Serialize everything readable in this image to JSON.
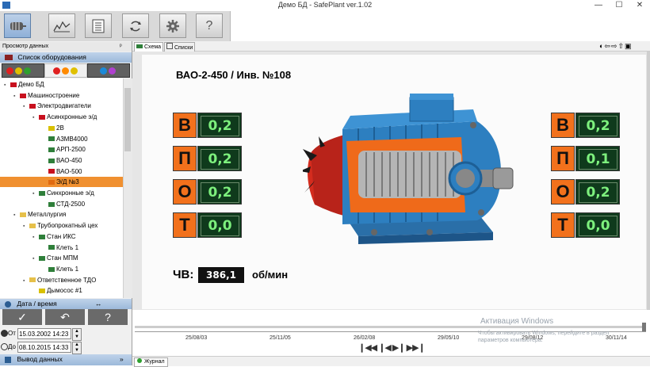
{
  "window": {
    "title": "Демо БД - SafePlant ver.1.02",
    "minimize": "—",
    "maximize": "☐",
    "close": "✕"
  },
  "toolbar": {
    "buttons": [
      "motor",
      "chart",
      "report",
      "refresh",
      "settings",
      "help"
    ],
    "help_label": "?"
  },
  "left": {
    "view_header": "Просмотр данных",
    "pin": "ᵖ",
    "equipment_header": "Список оборудования",
    "tree": [
      {
        "label": "Демо БД",
        "indent": 0,
        "icon": "red"
      },
      {
        "label": "Машиностроение",
        "indent": 1,
        "icon": "red"
      },
      {
        "label": "Электродвигатели",
        "indent": 2,
        "icon": "red"
      },
      {
        "label": "Асинхронные э/д",
        "indent": 3,
        "icon": "red"
      },
      {
        "label": "2В",
        "indent": 4,
        "icon": "yellow"
      },
      {
        "label": "А3МВ4000",
        "indent": 4,
        "icon": "green"
      },
      {
        "label": "АРП-2500",
        "indent": 4,
        "icon": "green"
      },
      {
        "label": "ВАО-450",
        "indent": 4,
        "icon": "green"
      },
      {
        "label": "ВАО-500",
        "indent": 4,
        "icon": "red"
      },
      {
        "label": "Э/Д №3",
        "indent": 4,
        "icon": "orange",
        "selected": true
      },
      {
        "label": "Синхронные э/д",
        "indent": 3,
        "icon": "green"
      },
      {
        "label": "СТД-2500",
        "indent": 4,
        "icon": "green"
      },
      {
        "label": "Металлургия",
        "indent": 1,
        "icon": "folder"
      },
      {
        "label": "Трубопрокатный цех",
        "indent": 2,
        "icon": "folder"
      },
      {
        "label": "Стан ИКС",
        "indent": 3,
        "icon": "green"
      },
      {
        "label": "Клеть 1",
        "indent": 4,
        "icon": "green"
      },
      {
        "label": "Стан МПМ",
        "indent": 3,
        "icon": "green"
      },
      {
        "label": "Клеть 1",
        "indent": 4,
        "icon": "green"
      },
      {
        "label": "Ответственное ТДО",
        "indent": 2,
        "icon": "folder"
      },
      {
        "label": "Дымосос #1",
        "indent": 3,
        "icon": "yellow"
      }
    ],
    "datetime_header": "Дата / время",
    "apply_label": "✓",
    "undo_label": "↶",
    "help_label": "?",
    "from_label": "От",
    "from_value": "15.03.2002 14:23",
    "to_label": "До",
    "to_value": "08.10.2015 14:33",
    "output_header": "Вывод данных"
  },
  "tabs": [
    "Схема",
    "Списки"
  ],
  "scheme": {
    "header": "ВАО-2-450  /  Инв. №108",
    "left_params": [
      {
        "letter": "В",
        "value": "0,2"
      },
      {
        "letter": "П",
        "value": "0,2"
      },
      {
        "letter": "О",
        "value": "0,2"
      },
      {
        "letter": "Т",
        "value": "0,0"
      }
    ],
    "right_params": [
      {
        "letter": "В",
        "value": "0,2"
      },
      {
        "letter": "П",
        "value": "0,1"
      },
      {
        "letter": "О",
        "value": "0,2"
      },
      {
        "letter": "Т",
        "value": "0,0"
      }
    ],
    "cv_label": "ЧВ:",
    "cv_value": "386,1",
    "cv_unit": "об/мин"
  },
  "timeline": {
    "ticks": [
      "25/08/03",
      "25/11/05",
      "26/02/08",
      "29/05/10",
      "29/08/12",
      "30/11/14"
    ],
    "controls": "❙◀◀ ❙◀ ▶❙ ▶▶❙"
  },
  "status": {
    "journal": "Журнал"
  },
  "watermark": {
    "line1": "Активация Windows",
    "line2": "Чтобы активировать Windows, перейдите в раздел параметров компьютера."
  },
  "colors": {
    "accent_orange": "#f2711c",
    "lcd_green": "#7df07d",
    "lcd_bg": "#0f3a1c",
    "motor_blue": "#2d7fc0",
    "motor_red": "#d42c1e"
  }
}
